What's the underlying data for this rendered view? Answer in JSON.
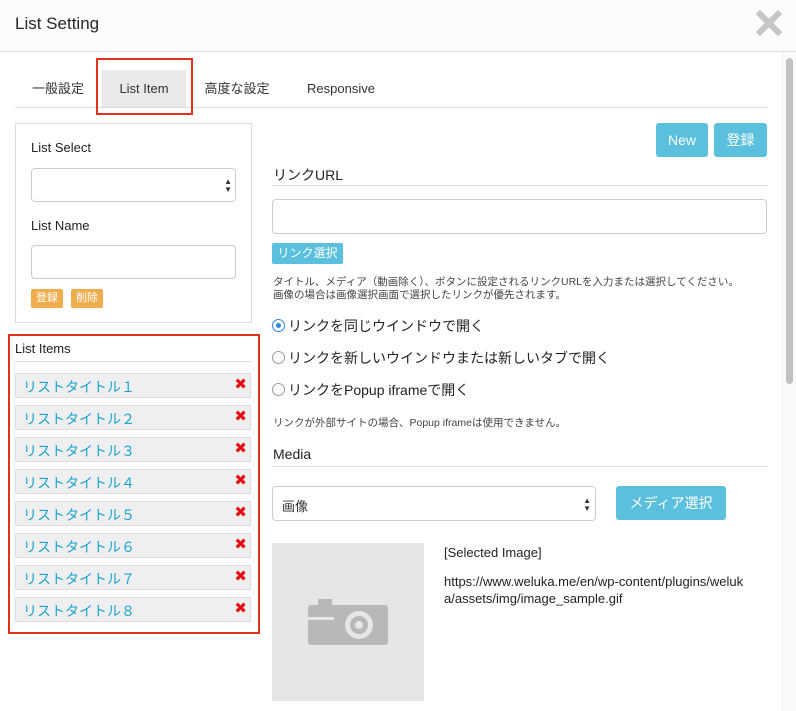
{
  "window": {
    "title": "List Setting"
  },
  "tabs": [
    {
      "label": "一般設定"
    },
    {
      "label": "List Item"
    },
    {
      "label": "高度な設定"
    },
    {
      "label": "Responsive"
    }
  ],
  "left_panel": {
    "list_select_label": "List Select",
    "list_select_value": "",
    "list_name_label": "List Name",
    "list_name_value": "",
    "register_label": "登録",
    "delete_label": "削除"
  },
  "list_items": {
    "title": "List Items",
    "items": [
      {
        "name": "リストタイトル１"
      },
      {
        "name": "リストタイトル２"
      },
      {
        "name": "リストタイトル３"
      },
      {
        "name": "リストタイトル４"
      },
      {
        "name": "リストタイトル５"
      },
      {
        "name": "リストタイトル６"
      },
      {
        "name": "リストタイトル７"
      },
      {
        "name": "リストタイトル８"
      }
    ],
    "delete_glyph": "✖"
  },
  "actions": {
    "new_label": "New",
    "register_label": "登録"
  },
  "link": {
    "section_title": "リンクURL",
    "url_value": "",
    "select_button": "リンク選択",
    "help_line1": "タイトル、メディア（動画除く）、ボタンに設定されるリンクURLを入力または選択してください。",
    "help_line2": "画像の場合は画像選択画面で選択したリンクが優先されます。",
    "options": [
      {
        "label": "リンクを同じウインドウで開く",
        "selected": true
      },
      {
        "label": "リンクを新しいウインドウまたは新しいタブで開く",
        "selected": false
      },
      {
        "label": "リンクをPopup iframeで開く",
        "selected": false
      }
    ],
    "note": "リンクが外部サイトの場合、Popup iframeは使用できません。"
  },
  "media": {
    "section_title": "Media",
    "type_value": "画像",
    "select_button": "メディア選択",
    "selected_label": "[Selected Image]",
    "selected_url_line1": "https://www.weluka.me/en/wp-content/plugins/weluk",
    "selected_url_line2": "a/assets/img/image_sample.gif"
  },
  "colors": {
    "accent": "#5bc0de",
    "warning": "#f0ad4e",
    "link": "#1aa3d8",
    "danger": "#e8101b",
    "highlight": "#e0301e"
  }
}
